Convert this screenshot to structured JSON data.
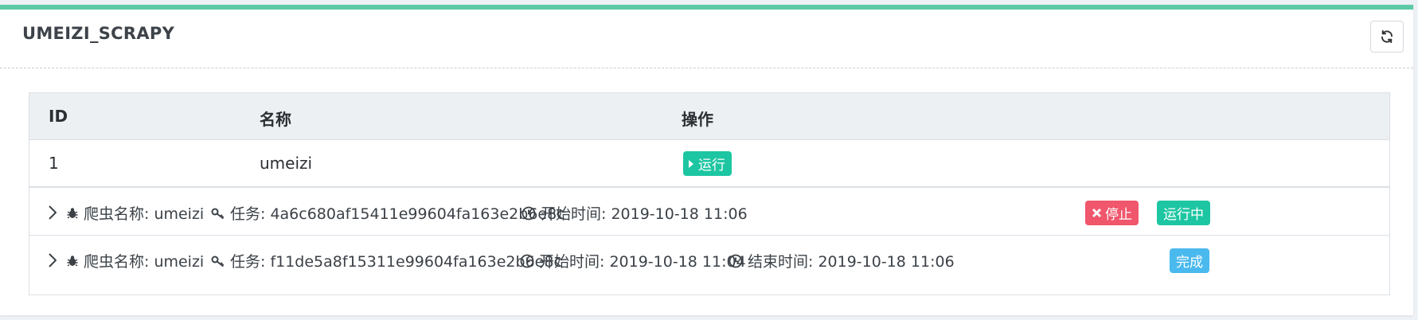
{
  "header": {
    "title": "UMEIZI_SCRAPY",
    "refresh_icon": "refresh-icon"
  },
  "table": {
    "columns": [
      "ID",
      "名称",
      "操作"
    ],
    "rows": [
      {
        "id": "1",
        "name": "umeizi",
        "action_label": "运行"
      }
    ]
  },
  "tasks": [
    {
      "spider_label": "爬虫名称: umeizi",
      "task_label": "任务: 4a6c680af15411e99604fa163e2b6e8c",
      "start_label": "开始时间: 2019-10-18 11:06",
      "stop_label": "停止",
      "status_label": "运行中"
    },
    {
      "spider_label": "爬虫名称: umeizi",
      "task_label": "任务: f11de5a8f15311e99604fa163e2b6e8c",
      "start_label": "开始时间: 2019-10-18 11:04",
      "end_label": "结束时间: 2019-10-18 11:06",
      "status_label": "完成"
    }
  ],
  "colors": {
    "accent": "#5cc9a7",
    "run": "#1dc6a2",
    "stop": "#f0566c",
    "done": "#4ab9ee"
  }
}
